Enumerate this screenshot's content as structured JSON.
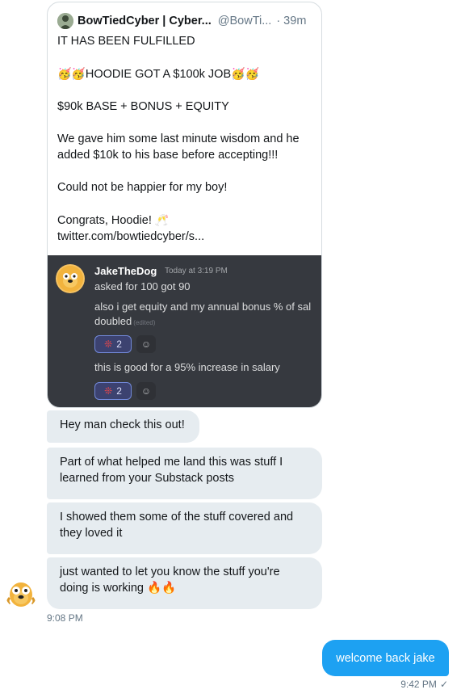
{
  "tweet": {
    "author_name": "BowTiedCyber | Cyber...",
    "author_handle": "@BowTi...",
    "time": "· 39m",
    "lines": [
      "IT HAS BEEN FULFILLED",
      "",
      "HOODIE GOT A $100k JOB",
      "",
      "$90k BASE + BONUS + EQUITY",
      "",
      "We gave him some last minute wisdom and he",
      "added $10k to his base before accepting!!!",
      "",
      "Could not be happier for my boy!",
      "",
      "Congrats, Hoodie!",
      "twitter.com/bowtiedcyber/s..."
    ],
    "party_emoji": "🥳🥳",
    "cheers_emoji": "🥂"
  },
  "discord": {
    "username": "JakeTheDog",
    "timestamp": "Today at 3:19 PM",
    "msg1": "asked for 100 got 90",
    "msg2a": "also i get equity and my annual bonus % of sal",
    "msg2b": "doubled",
    "edited": "(edited)",
    "reaction_count": "2",
    "msg3": "this is good for a 95% increase in salary",
    "reaction_count_2": "2"
  },
  "messages_in": [
    "Hey man check this out!",
    "Part of what helped me land this was stuff I learned from your Substack posts",
    "I showed them some of the stuff covered and they loved it",
    "just wanted to let you know the stuff you're doing is working"
  ],
  "fire_emoji": "🔥🔥",
  "time_in": "9:08 PM",
  "message_out": "welcome back jake",
  "time_out": "9:42 PM",
  "colors": {
    "accent": "#1da1f2",
    "bubble_in": "#e6ecf0",
    "discord_bg": "#36393f"
  }
}
